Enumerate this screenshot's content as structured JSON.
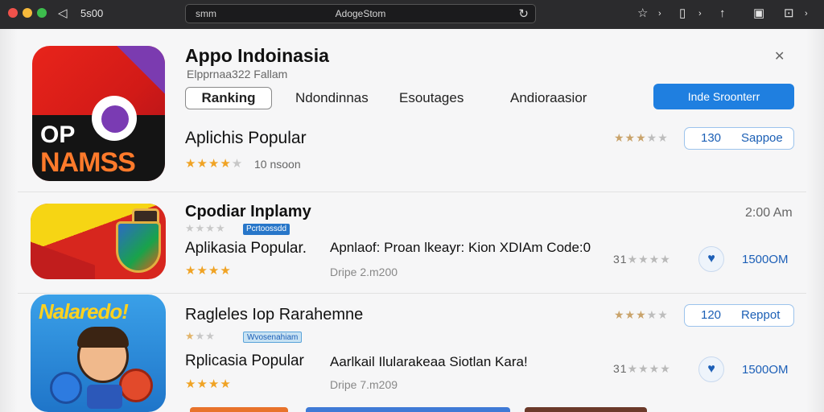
{
  "titlebar": {
    "left_text": "5s00",
    "url_left": "smm",
    "url_center": "AdogeStom",
    "icons": [
      "back-icon",
      "reload-icon",
      "bookmark-icon",
      "share-icon",
      "download-icon",
      "sidebar-icon",
      "window-icon"
    ]
  },
  "header": {
    "title": "Appo Indoinasia",
    "subtitle": "Elpprnaa322 Fallam",
    "close_glyph": "✕",
    "tabs": [
      "Ranking",
      "Ndondinnas",
      "Esoutages",
      "Andioraasior"
    ],
    "cta_label": "Inde Sroonterr"
  },
  "apps": [
    {
      "title": "Aplichis Popular",
      "rating": 4,
      "meta": "10 nsoon",
      "count": "130",
      "button": "Sappoe",
      "icon_text": [
        "OP",
        "NAMSS"
      ]
    },
    {
      "title": "Cpodiar Inplamy",
      "badge": "Pcrtoossdd",
      "subtitle": "Aplikasia Popular.",
      "desc": "Apnlaof: Proan lkeayr: Kion XDIAm Code:0",
      "meta": "Dripe 2.m200",
      "time": "2:00 Am",
      "rating_text": "31",
      "size": "1500OM"
    },
    {
      "title": "Ragleles Iop Rarahemne",
      "badge": "Wvosenahiam",
      "subtitle": "Rplicasia Popular",
      "desc": "Aarlkail Ilularakeaa Siotlan Kara!",
      "meta": "Dripe 7.m209",
      "count": "120",
      "button": "Reppot",
      "rating_text": "31",
      "size": "1500OM",
      "icon_text": "Nalaredo!"
    }
  ],
  "colors": {
    "accent": "#1f7fe0",
    "star": "#f0a324",
    "titlebar": "#2b2b2d"
  }
}
